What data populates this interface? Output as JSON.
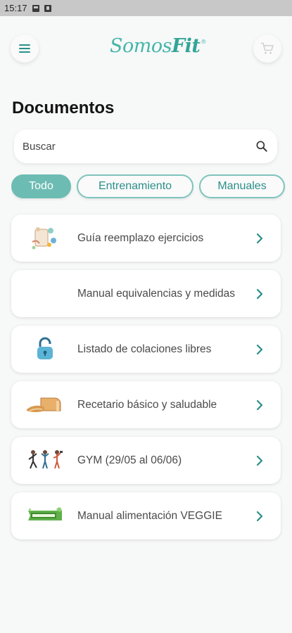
{
  "status_bar": {
    "time": "15:17"
  },
  "header": {
    "logo_main": "Somos",
    "logo_accent": "Fit",
    "logo_reg": "®"
  },
  "page": {
    "title": "Documentos"
  },
  "search": {
    "placeholder": "Buscar",
    "value": ""
  },
  "filters": [
    {
      "label": "Todo",
      "active": true
    },
    {
      "label": "Entrenamiento",
      "active": false
    },
    {
      "label": "Manuales",
      "active": false
    }
  ],
  "documents": [
    {
      "label": "Guía reemplazo ejercicios",
      "icon": "exercise-illustration-icon"
    },
    {
      "label": "Manual equivalencias y medidas",
      "icon": ""
    },
    {
      "label": "Listado de colaciones libres",
      "icon": "padlock-icon"
    },
    {
      "label": "Recetario básico y saludable",
      "icon": "bread-icon"
    },
    {
      "label": "GYM (29/05 al 06/06)",
      "icon": "gym-people-icon"
    },
    {
      "label": "Manual alimentación VEGGIE",
      "icon": "plant-based-banner-icon"
    }
  ],
  "colors": {
    "accent": "#6dbcb3",
    "accent_dark": "#2b8f8a",
    "background": "#f7f8f8",
    "chevron": "#2b8f8a"
  }
}
